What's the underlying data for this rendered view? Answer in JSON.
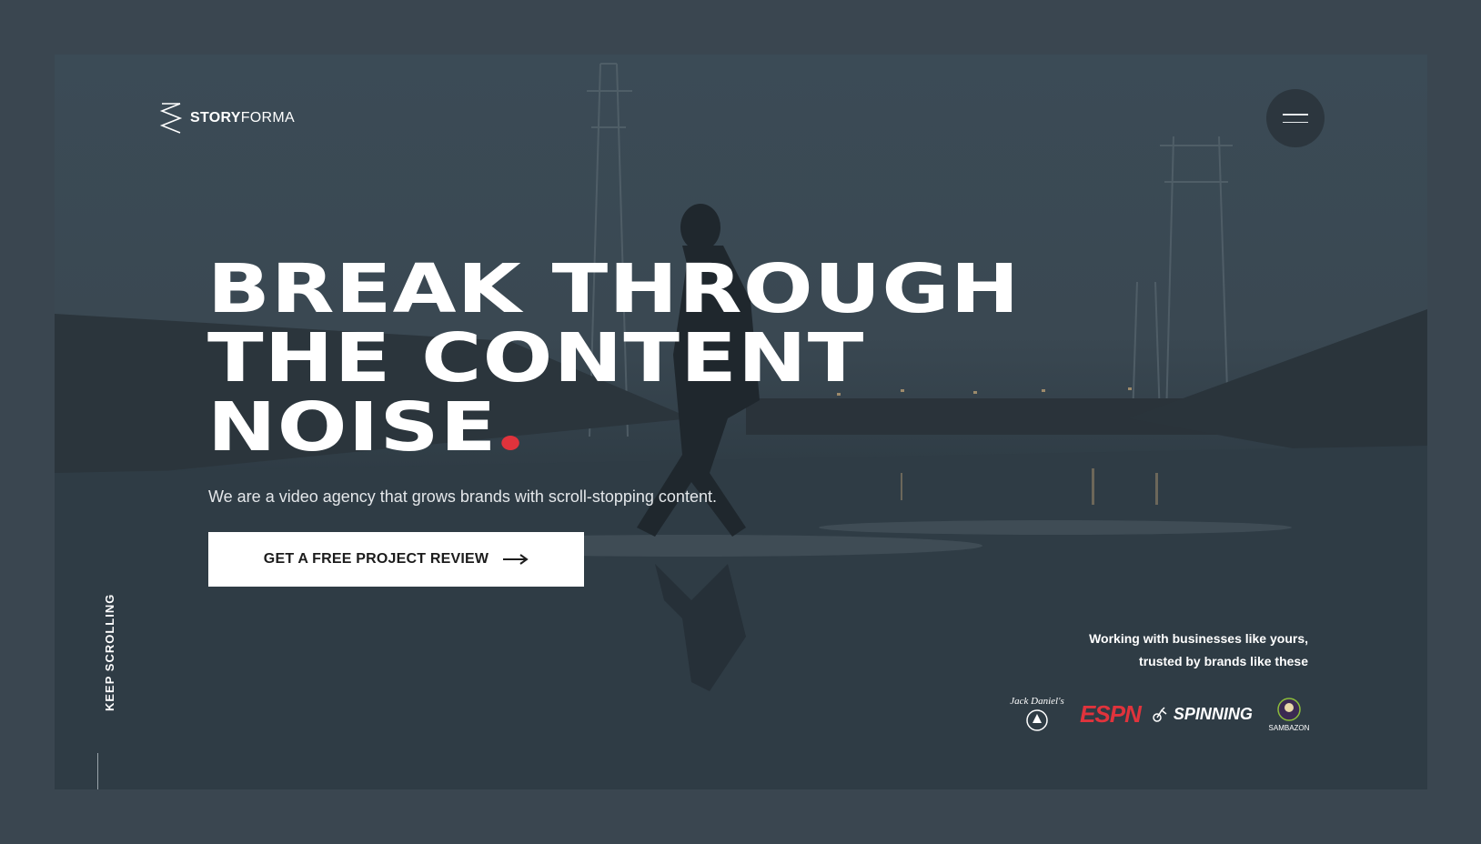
{
  "brand": {
    "name_bold": "STORY",
    "name_light": "FORMA",
    "logo_icon": "storyforma-logo-icon"
  },
  "menu": {
    "icon": "hamburger-menu-icon"
  },
  "hero": {
    "title_lines": [
      "BREAK THROUGH",
      "THE CONTENT",
      "NOISE"
    ],
    "title_dot_color": "#e0333c",
    "subtitle": "We are a video agency that grows brands with scroll-stopping content.",
    "cta_label": "GET A FREE PROJECT REVIEW",
    "cta_icon": "arrow-right-icon"
  },
  "scroll_hint": "KEEP SCROLLING",
  "trusted": {
    "line1": "Working with businesses like yours,",
    "line2": "trusted by brands like these",
    "brands": [
      {
        "name": "Jack Daniel's",
        "label": "Jack Daniel's"
      },
      {
        "name": "ESPN",
        "label": "ESPN"
      },
      {
        "name": "Spinning",
        "label": "SPINNING"
      },
      {
        "name": "Sambazon",
        "label": "SAMBAZON"
      }
    ]
  },
  "colors": {
    "accent": "#e0333c",
    "page_bg": "#3a4650",
    "menu_bg": "#2c363e"
  }
}
